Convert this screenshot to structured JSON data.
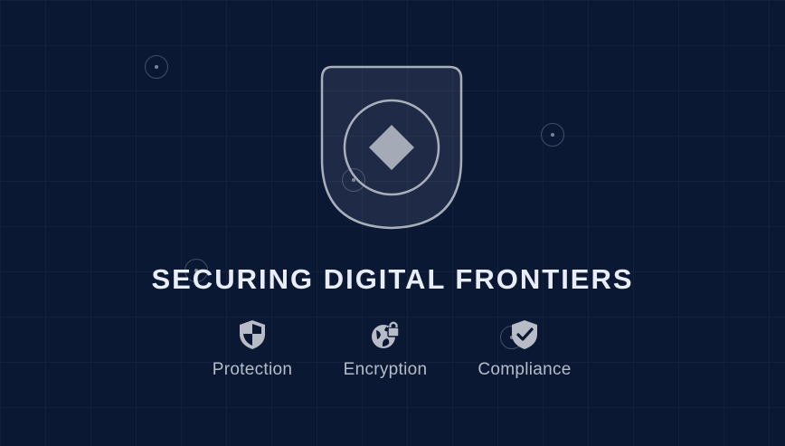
{
  "hero": {
    "title": "SECURING DIGITAL FRONTIERS"
  },
  "features": [
    {
      "label": "Protection",
      "icon": "shield-half-icon"
    },
    {
      "label": "Encryption",
      "icon": "globe-lock-icon"
    },
    {
      "label": "Compliance",
      "icon": "shield-check-icon"
    }
  ],
  "colors": {
    "background": "#0b1833",
    "title": "#e9edf5",
    "label": "#b6bcc8",
    "icon": "#b7bcc7"
  }
}
